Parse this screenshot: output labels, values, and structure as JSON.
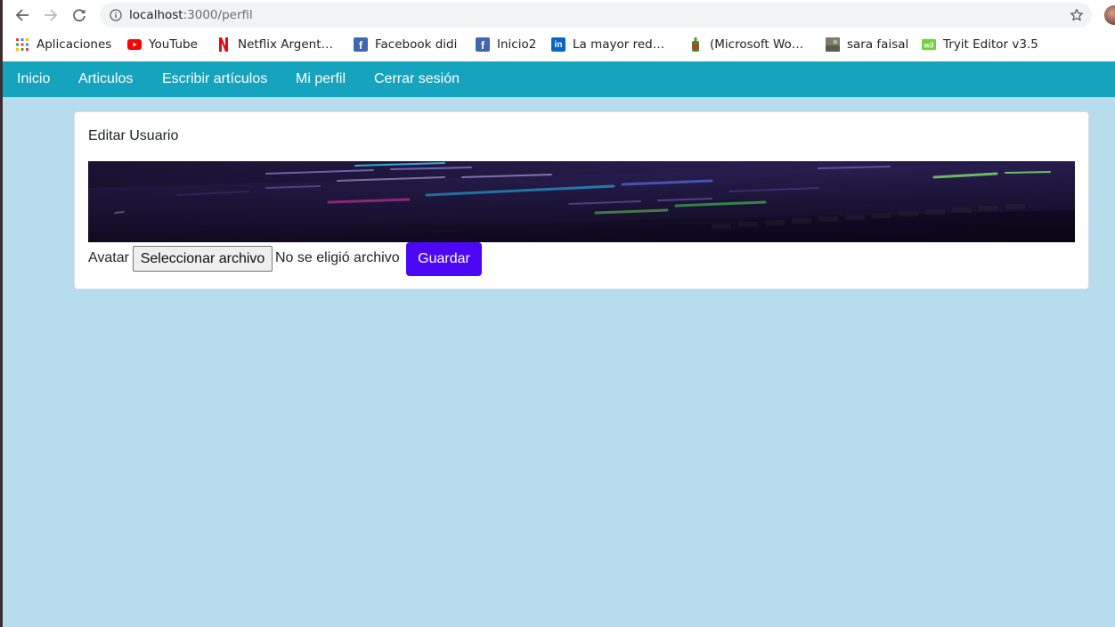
{
  "browser": {
    "url_host": "localhost",
    "url_rest": ":3000/perfil",
    "bookmarks": [
      {
        "label": "Aplicaciones",
        "icon": "apps-grid-icon"
      },
      {
        "label": "YouTube",
        "icon": "youtube-icon"
      },
      {
        "label": "Netflix Argent…",
        "icon": "netflix-icon"
      },
      {
        "label": "Facebook didi",
        "icon": "facebook-icon"
      },
      {
        "label": "Inicio2",
        "icon": "facebook-icon"
      },
      {
        "label": "La mayor red…",
        "icon": "linkedin-icon"
      },
      {
        "label": "(Microsoft Wo…",
        "icon": "bottle-icon"
      },
      {
        "label": "sara faisal",
        "icon": "photo-icon"
      },
      {
        "label": "Tryit Editor v3.5",
        "icon": "w3schools-icon"
      }
    ]
  },
  "navbar": {
    "items": [
      "Inicio",
      "Articulos",
      "Escribir artículos",
      "Mi perfil",
      "Cerrar sesión"
    ]
  },
  "form": {
    "title": "Editar Usuario",
    "avatar_label": "Avatar",
    "file_button": "Seleccionar archivo",
    "file_status": "No se eligió archivo",
    "save_label": "Guardar"
  },
  "colors": {
    "navbar": "#16a3bd",
    "background": "#b7dcee",
    "save_button": "#4c08f4"
  }
}
